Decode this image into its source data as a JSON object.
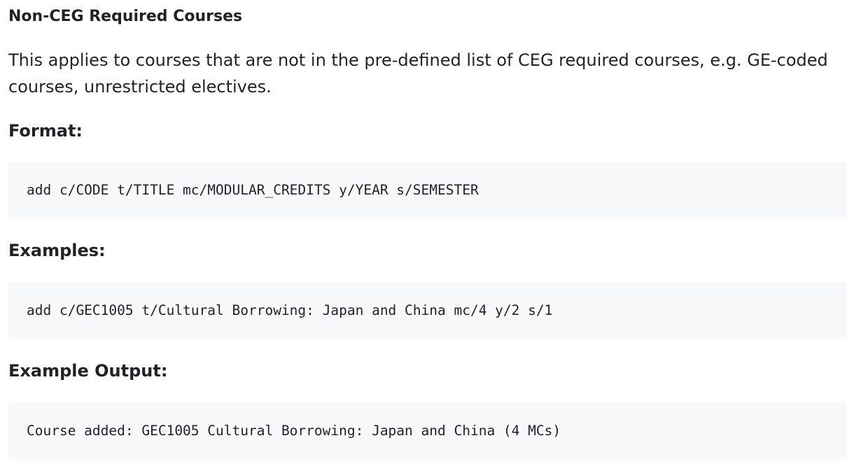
{
  "section": {
    "title": "Non-CEG Required Courses",
    "description": "This applies to courses that are not in the pre-defined list of CEG required courses, e.g. GE-coded courses, unrestricted electives."
  },
  "format": {
    "label": "Format:",
    "code": "add c/CODE t/TITLE mc/MODULAR_CREDITS y/YEAR s/SEMESTER"
  },
  "examples": {
    "label": "Examples:",
    "code": "add c/GEC1005 t/Cultural Borrowing: Japan and China mc/4 y/2 s/1"
  },
  "example_output": {
    "label": "Example Output:",
    "code": "Course added: GEC1005 Cultural Borrowing: Japan and China (4 MCs)"
  },
  "colors": {
    "text": "#1f2328",
    "code_background": "#f6f8fa"
  }
}
